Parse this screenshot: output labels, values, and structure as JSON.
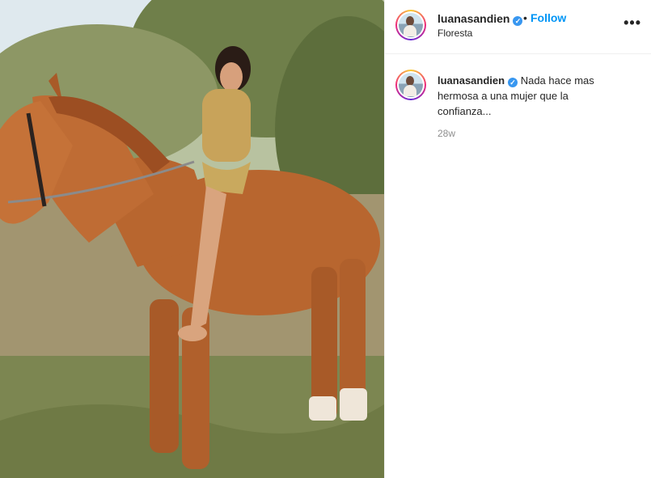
{
  "post": {
    "username": "luanasandien",
    "verified_mark": "✓",
    "dot": "•",
    "follow_label": "Follow",
    "location": "Floresta",
    "more_icon": "•••",
    "caption_username": "luanasandien",
    "caption_text": "Nada hace mas hermosa a una mujer que la confianza...",
    "timestamp": "28w"
  },
  "colors": {
    "accent": "#0095f6",
    "verified": "#3897f0",
    "text": "#262626",
    "muted": "#8e8e8e"
  }
}
